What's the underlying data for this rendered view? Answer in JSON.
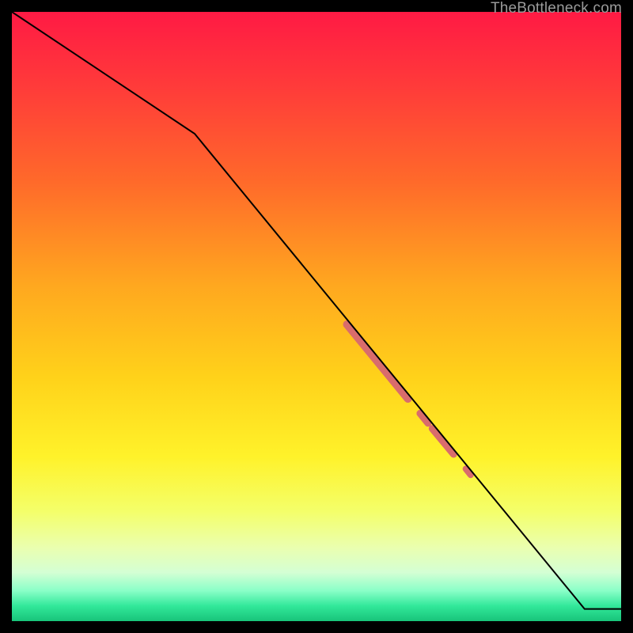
{
  "watermark": "TheBottleneck.com",
  "chart_data": {
    "type": "line",
    "title": "",
    "xlabel": "",
    "ylabel": "",
    "xlim": [
      0,
      100
    ],
    "ylim": [
      0,
      100
    ],
    "grid": false,
    "series": [
      {
        "name": "bottleneck-curve",
        "x": [
          0,
          30,
          94,
          100
        ],
        "y": [
          100,
          80,
          2,
          2
        ],
        "color": "#000000",
        "width": 2
      }
    ],
    "highlight_segments": [
      {
        "x0": 55,
        "y0": 48.7,
        "x1": 65,
        "y1": 36.5,
        "color": "#d96c6c",
        "width": 10
      },
      {
        "x0": 67,
        "y0": 34.1,
        "x1": 68.3,
        "y1": 32.5,
        "color": "#d96c6c",
        "width": 9
      },
      {
        "x0": 69,
        "y0": 31.6,
        "x1": 72.5,
        "y1": 27.4,
        "color": "#d96c6c",
        "width": 9
      },
      {
        "x0": 74.5,
        "y0": 25.0,
        "x1": 75.3,
        "y1": 24.0,
        "color": "#d96c6c",
        "width": 8
      }
    ],
    "background_gradient": {
      "stops": [
        {
          "offset": 0.0,
          "color": "#ff1a44"
        },
        {
          "offset": 0.12,
          "color": "#ff3a3a"
        },
        {
          "offset": 0.28,
          "color": "#ff6a2a"
        },
        {
          "offset": 0.45,
          "color": "#ffa81f"
        },
        {
          "offset": 0.6,
          "color": "#ffd21a"
        },
        {
          "offset": 0.73,
          "color": "#fff22a"
        },
        {
          "offset": 0.82,
          "color": "#f4ff6a"
        },
        {
          "offset": 0.88,
          "color": "#eaffb0"
        },
        {
          "offset": 0.92,
          "color": "#d4ffd4"
        },
        {
          "offset": 0.95,
          "color": "#8affc8"
        },
        {
          "offset": 0.975,
          "color": "#32e89a"
        },
        {
          "offset": 1.0,
          "color": "#18c47a"
        }
      ]
    }
  }
}
